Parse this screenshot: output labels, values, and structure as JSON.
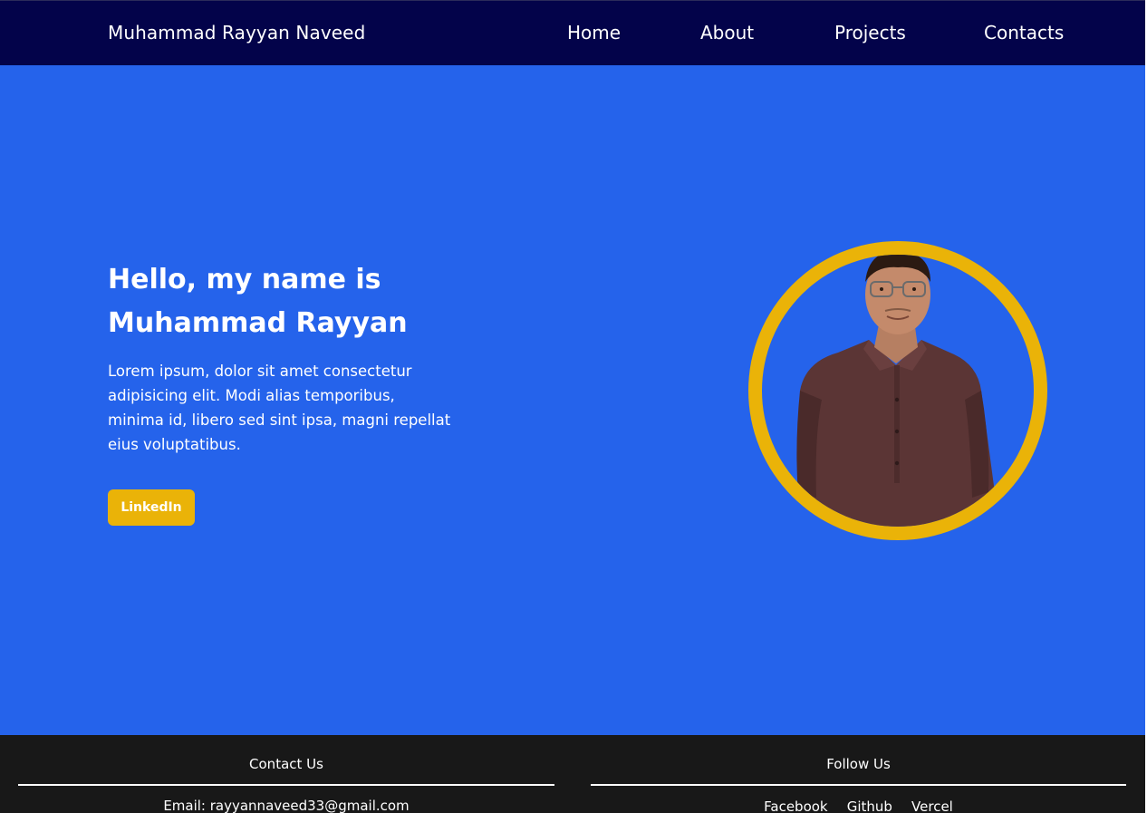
{
  "navbar": {
    "brand": "Muhammad Rayyan Naveed",
    "links": [
      "Home",
      "About",
      "Projects",
      "Contacts"
    ]
  },
  "hero": {
    "title": "Hello, my name is Muhammad Rayyan",
    "description": "Lorem ipsum, dolor sit amet consectetur adipisicing elit. Modi alias temporibus, minima id, libero sed sint ipsa, magni repellat eius voluptatibus.",
    "button_label": "LinkedIn"
  },
  "footer": {
    "contact_heading": "Contact Us",
    "email": "Email: rayyannaveed33@gmail.com",
    "follow_heading": "Follow Us",
    "social_links": [
      "Facebook",
      "Github",
      "Vercel"
    ]
  },
  "colors": {
    "navbar_bg": "#03034a",
    "hero_bg": "#2563eb",
    "accent": "#eab308",
    "footer_bg": "#181818",
    "text": "#ffffff"
  }
}
